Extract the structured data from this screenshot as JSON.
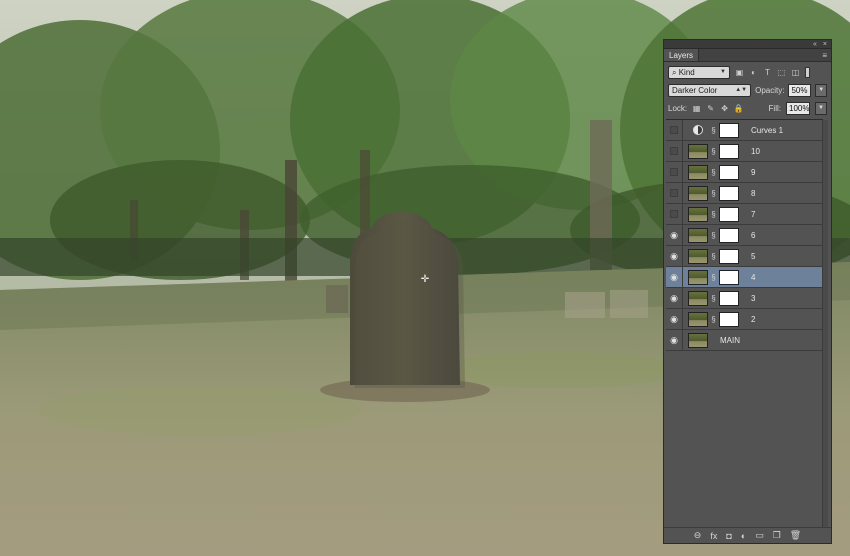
{
  "panel": {
    "tab_label": "Layers",
    "collapse_glyph": "«",
    "close_glyph": "×",
    "menu_glyph": "≡",
    "filter": {
      "label": "Kind",
      "search_icon": "search-icon"
    },
    "blend_mode": "Darker Color",
    "opacity_label": "Opacity:",
    "opacity_value": "50%",
    "lock_label": "Lock:",
    "fill_label": "Fill:",
    "fill_value": "100%"
  },
  "layers": [
    {
      "name": "Curves 1",
      "visible": false,
      "type": "adjustment",
      "selected": false
    },
    {
      "name": "10",
      "visible": false,
      "type": "image",
      "selected": false
    },
    {
      "name": "9",
      "visible": false,
      "type": "image",
      "selected": false
    },
    {
      "name": "8",
      "visible": false,
      "type": "image",
      "selected": false
    },
    {
      "name": "7",
      "visible": false,
      "type": "image",
      "selected": false
    },
    {
      "name": "6",
      "visible": true,
      "type": "image",
      "selected": false
    },
    {
      "name": "5",
      "visible": true,
      "type": "image",
      "selected": false
    },
    {
      "name": "4",
      "visible": true,
      "type": "image",
      "selected": true
    },
    {
      "name": "3",
      "visible": true,
      "type": "image",
      "selected": false
    },
    {
      "name": "2",
      "visible": true,
      "type": "image",
      "selected": false
    },
    {
      "name": "MAIN",
      "visible": true,
      "type": "image",
      "selected": false
    }
  ],
  "footer_icons": [
    "link-icon",
    "fx-icon",
    "mask-icon",
    "adjustment-icon",
    "folder-icon",
    "new-layer-icon",
    "trash-icon"
  ],
  "footer_glyphs": [
    "⊖",
    "fx",
    "◘",
    "◐",
    "▭",
    "❐",
    "🗑"
  ],
  "colors": {
    "panel_bg": "#535353",
    "selected_row": "#6e819b",
    "canvas_bg": "#8a8c78"
  },
  "canvas": {
    "description_icon": "crosshair-cursor-icon"
  }
}
